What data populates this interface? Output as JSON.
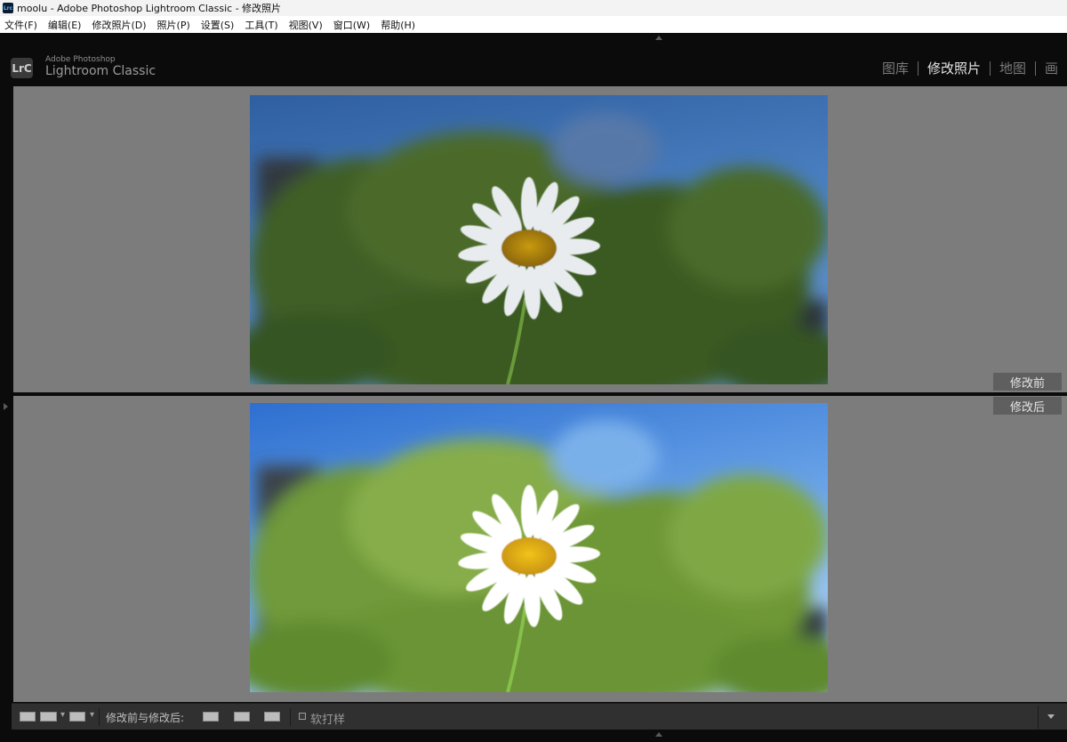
{
  "window": {
    "title": "moolu - Adobe Photoshop Lightroom Classic - 修改照片",
    "icon_label": "Lrc"
  },
  "menu": [
    {
      "label": "文件(F)"
    },
    {
      "label": "编辑(E)"
    },
    {
      "label": "修改照片(D)"
    },
    {
      "label": "照片(P)"
    },
    {
      "label": "设置(S)"
    },
    {
      "label": "工具(T)"
    },
    {
      "label": "视图(V)"
    },
    {
      "label": "窗口(W)"
    },
    {
      "label": "帮助(H)"
    }
  ],
  "identity": {
    "badge": "LrC",
    "brand_small": "Adobe Photoshop",
    "brand_large": "Lightroom Classic"
  },
  "modules": [
    {
      "label": "图库",
      "active": false
    },
    {
      "label": "修改照片",
      "active": true
    },
    {
      "label": "地图",
      "active": false
    },
    {
      "label": "画",
      "active": false
    }
  ],
  "panes": {
    "before_label": "修改前",
    "after_label": "修改后"
  },
  "toolbar": {
    "compare_label": "修改前与修改后:",
    "softproof_label": "软打样"
  },
  "icons": {
    "top_panel": "triangle-up-icon",
    "left_panel": "triangle-right-icon",
    "bottom_panel": "triangle-up-icon",
    "toolbar_menu": "chevron-down-icon"
  }
}
